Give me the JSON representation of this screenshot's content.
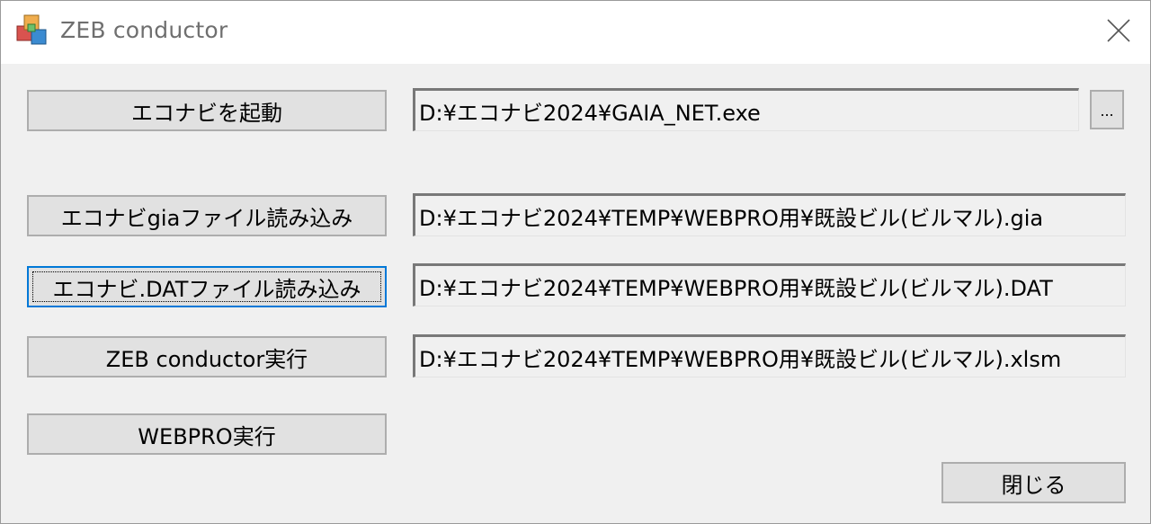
{
  "window": {
    "title": "ZEB conductor"
  },
  "rows": {
    "launch": {
      "button_label": "エコナビを起動",
      "path": "D:¥エコナビ2024¥GAIA_NET.exe",
      "browse_label": "..."
    },
    "gia": {
      "button_label": "エコナビgiaファイル読み込み",
      "path": "D:¥エコナビ2024¥TEMP¥WEBPRO用¥既設ビル(ビルマル).gia"
    },
    "dat": {
      "button_label": "エコナビ.DATファイル読み込み",
      "path": "D:¥エコナビ2024¥TEMP¥WEBPRO用¥既設ビル(ビルマル).DAT"
    },
    "zeb": {
      "button_label": "ZEB conductor実行",
      "path": "D:¥エコナビ2024¥TEMP¥WEBPRO用¥既設ビル(ビルマル).xlsm"
    },
    "webpro": {
      "button_label": "WEBPRO実行"
    }
  },
  "footer": {
    "close_label": "閉じる"
  }
}
